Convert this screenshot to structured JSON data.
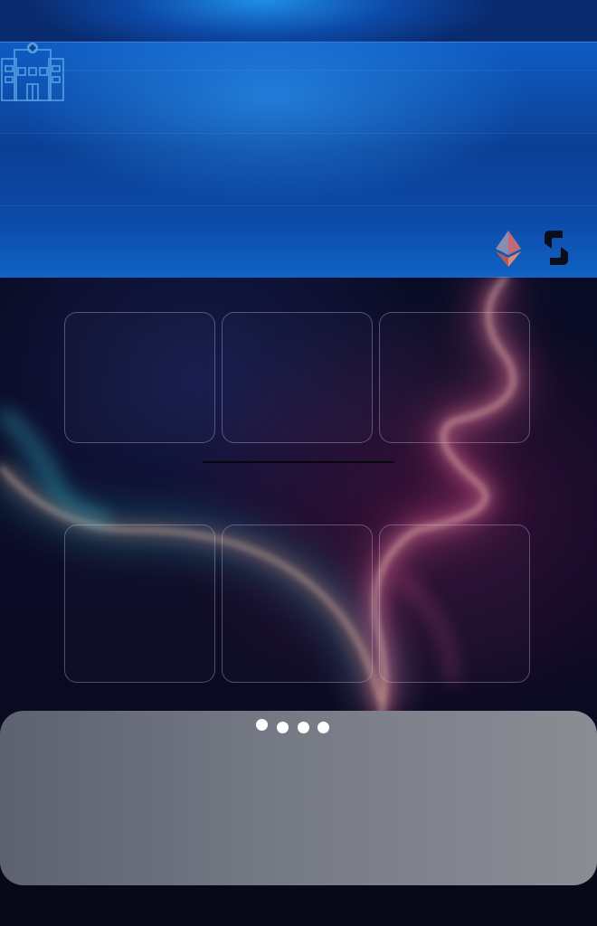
{
  "header": {
    "logo_icon": "hospital-icon",
    "right_icons": [
      "ethereum-icon",
      "sync-icon"
    ]
  },
  "grid": {
    "top_row": [
      "tile-1",
      "tile-2",
      "tile-3"
    ],
    "bottom_row": [
      "tile-4",
      "tile-5",
      "tile-6"
    ]
  },
  "pager": {
    "dot_count": 4,
    "active_index": 0
  },
  "colors": {
    "header_blue": "#0b4aa8",
    "background": "#0a0b24",
    "dock_gray": "#777b86",
    "tile_border": "#c8c8e6",
    "light_cyan": "#3fd6e8",
    "light_pink": "#ff7ab0",
    "light_orange": "#ffb070"
  }
}
